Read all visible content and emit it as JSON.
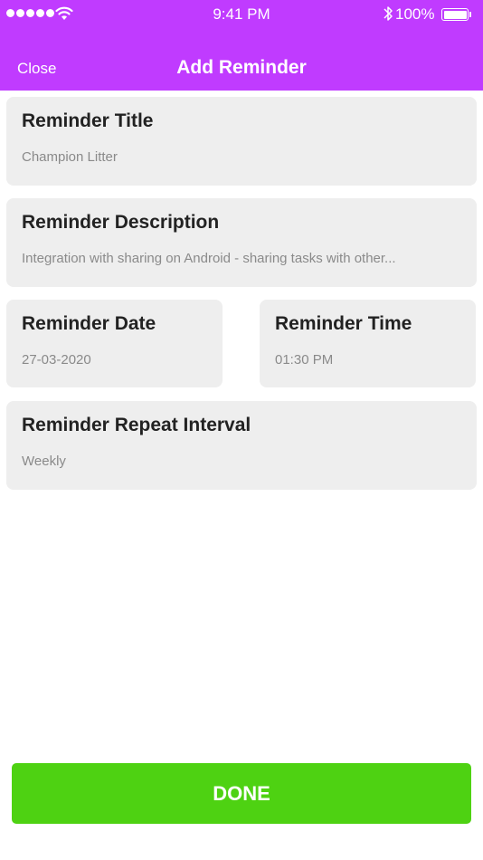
{
  "status_bar": {
    "time": "9:41 PM",
    "battery_percent": "100%",
    "signal_icon": "signal-dots-icon",
    "wifi_icon": "wifi-icon",
    "bluetooth_icon": "bluetooth-icon",
    "battery_icon": "battery-icon"
  },
  "nav": {
    "close_label": "Close",
    "title": "Add Reminder"
  },
  "fields": {
    "title": {
      "label": "Reminder Title",
      "value": "Champion Litter"
    },
    "description": {
      "label": "Reminder Description",
      "value": "Integration with sharing on Android - sharing tasks with other..."
    },
    "date": {
      "label": "Reminder Date",
      "value": "27-03-2020"
    },
    "time": {
      "label": "Reminder Time",
      "value": "01:30 PM"
    },
    "repeat": {
      "label": "Reminder Repeat Interval",
      "value": "Weekly"
    }
  },
  "actions": {
    "done_label": "DONE"
  },
  "colors": {
    "header": "#c03bff",
    "card_bg": "#eeeeee",
    "done_button": "#4ed212"
  }
}
